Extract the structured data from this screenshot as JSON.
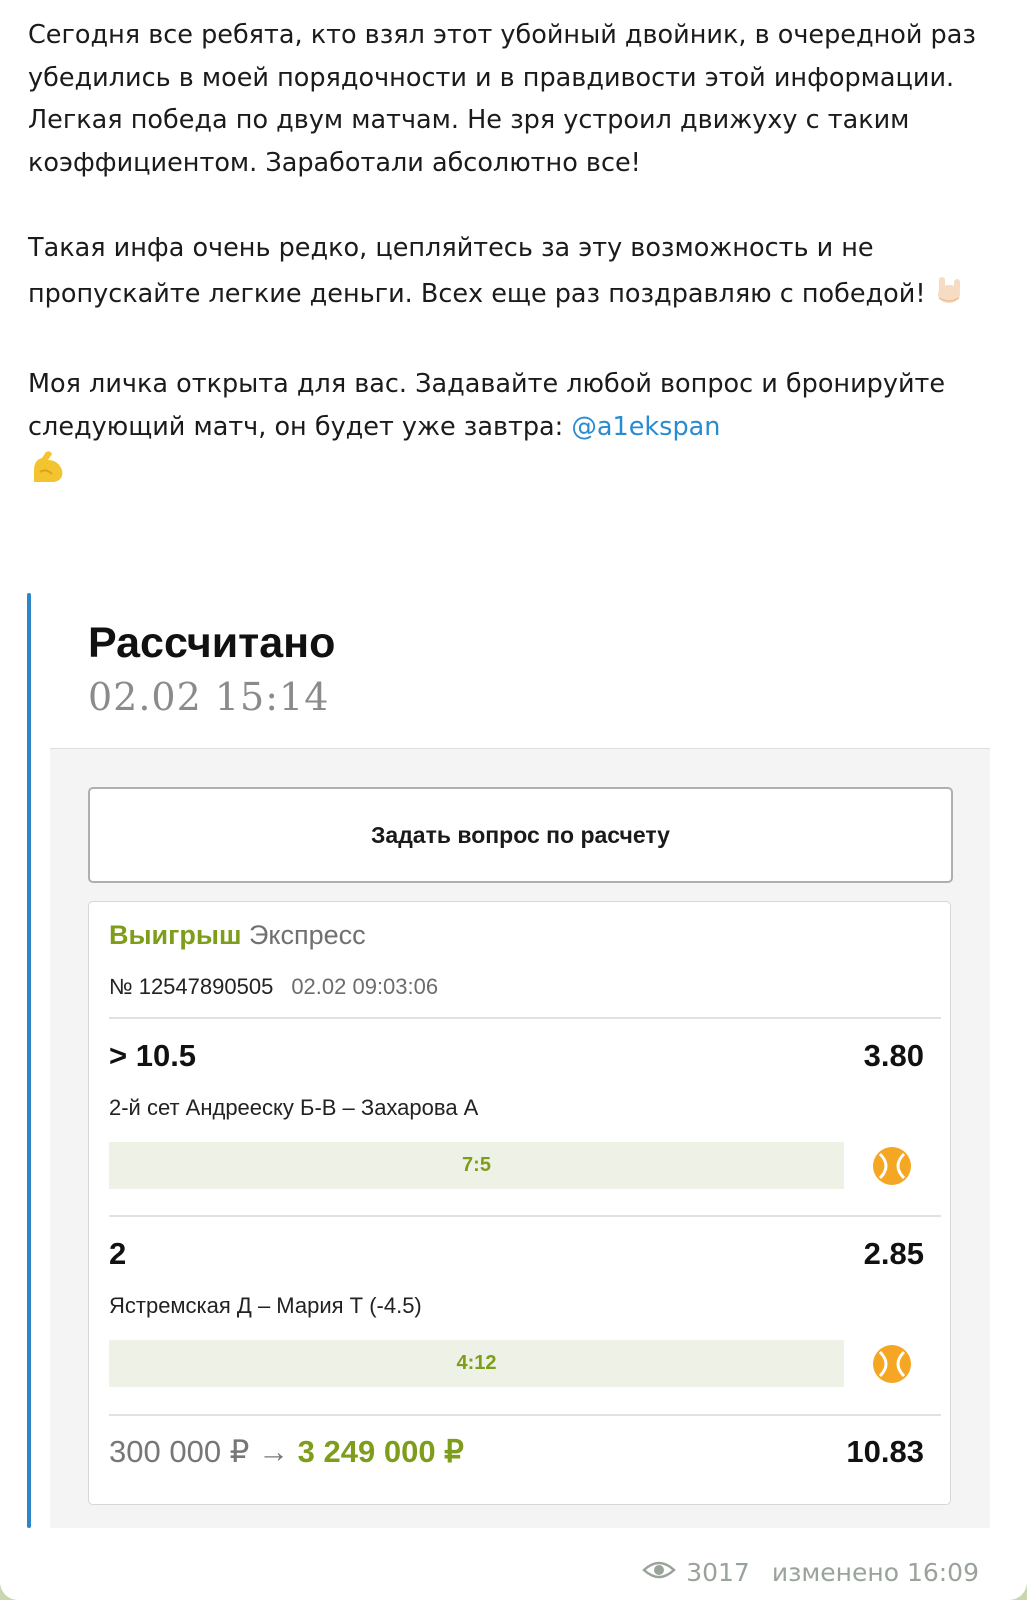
{
  "message": {
    "p1": "Сегодня все ребята, кто взял этот убойный двойник, в очередной раз убедились в моей порядочности и в правдивости этой информации. Легкая победа по двум матчам. Не зря устроил движуху с таким коэффициентом. Заработали абсолютно все!",
    "p2": "Такая инфа очень редко, цепляйтесь за эту возможность и не пропускайте легкие деньги. Всех еще раз поздравляю с победой!",
    "p3_text": "Моя личка открыта для вас. Задавайте любой вопрос и бронируйте следующий матч, он будет уже завтра: ",
    "p3_mention": "@a1ekspan"
  },
  "bet_screenshot": {
    "title": "Рассчитано",
    "datetime": "02.02 15:14",
    "ask_button_label": "Задать вопрос по расчету",
    "status_result": "Выигрыш",
    "status_type": "Экспресс",
    "bet_number": "№ 12547890505",
    "bet_time": "02.02  09:03:06",
    "events": [
      {
        "pick": "> 10.5",
        "odd": "3.80",
        "match": "2-й сет Андрееску Б-В – Захарова А",
        "score": "7:5",
        "icon": "tennis-ball-icon"
      },
      {
        "pick": "2",
        "odd": "2.85",
        "match": "Ястремская Д – Мария Т (-4.5)",
        "score": "4:12",
        "icon": "tennis-ball-icon"
      }
    ],
    "stake": "300 000 ₽",
    "arrow": "→",
    "payout": "3 249 000 ₽",
    "total_odd": "10.83"
  },
  "footer": {
    "views": "3017",
    "edited": "изменено 16:09"
  },
  "colors": {
    "win_green": "#7e9d1a",
    "mention_blue": "#2a8bd0",
    "quote_bar": "#2e86c9",
    "tennis_orange": "#f5a623"
  }
}
